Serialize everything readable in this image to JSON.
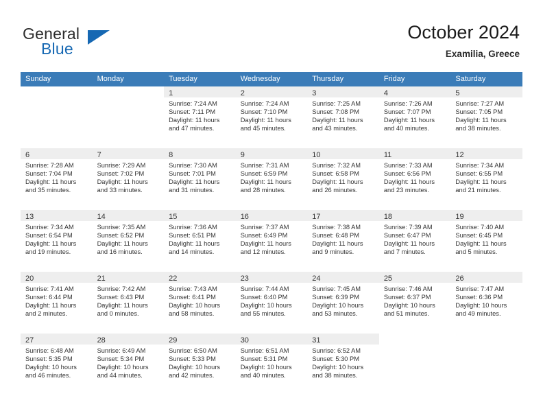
{
  "brand": {
    "name_top": "General",
    "name_bottom": "Blue",
    "accent_color": "#1668b3"
  },
  "header": {
    "month_title": "October 2024",
    "location": "Examilia, Greece"
  },
  "calendar": {
    "header_bg": "#3b7cb8",
    "separator_color": "#1668b3",
    "daynum_band_color": "#eeeeee",
    "weekdays": [
      "Sunday",
      "Monday",
      "Tuesday",
      "Wednesday",
      "Thursday",
      "Friday",
      "Saturday"
    ],
    "weeks": [
      [
        {
          "day": "",
          "sunrise": "",
          "sunset": "",
          "daylight_line1": "",
          "daylight_line2": ""
        },
        {
          "day": "",
          "sunrise": "",
          "sunset": "",
          "daylight_line1": "",
          "daylight_line2": ""
        },
        {
          "day": "1",
          "sunrise": "Sunrise: 7:24 AM",
          "sunset": "Sunset: 7:11 PM",
          "daylight_line1": "Daylight: 11 hours",
          "daylight_line2": "and 47 minutes."
        },
        {
          "day": "2",
          "sunrise": "Sunrise: 7:24 AM",
          "sunset": "Sunset: 7:10 PM",
          "daylight_line1": "Daylight: 11 hours",
          "daylight_line2": "and 45 minutes."
        },
        {
          "day": "3",
          "sunrise": "Sunrise: 7:25 AM",
          "sunset": "Sunset: 7:08 PM",
          "daylight_line1": "Daylight: 11 hours",
          "daylight_line2": "and 43 minutes."
        },
        {
          "day": "4",
          "sunrise": "Sunrise: 7:26 AM",
          "sunset": "Sunset: 7:07 PM",
          "daylight_line1": "Daylight: 11 hours",
          "daylight_line2": "and 40 minutes."
        },
        {
          "day": "5",
          "sunrise": "Sunrise: 7:27 AM",
          "sunset": "Sunset: 7:05 PM",
          "daylight_line1": "Daylight: 11 hours",
          "daylight_line2": "and 38 minutes."
        }
      ],
      [
        {
          "day": "6",
          "sunrise": "Sunrise: 7:28 AM",
          "sunset": "Sunset: 7:04 PM",
          "daylight_line1": "Daylight: 11 hours",
          "daylight_line2": "and 35 minutes."
        },
        {
          "day": "7",
          "sunrise": "Sunrise: 7:29 AM",
          "sunset": "Sunset: 7:02 PM",
          "daylight_line1": "Daylight: 11 hours",
          "daylight_line2": "and 33 minutes."
        },
        {
          "day": "8",
          "sunrise": "Sunrise: 7:30 AM",
          "sunset": "Sunset: 7:01 PM",
          "daylight_line1": "Daylight: 11 hours",
          "daylight_line2": "and 31 minutes."
        },
        {
          "day": "9",
          "sunrise": "Sunrise: 7:31 AM",
          "sunset": "Sunset: 6:59 PM",
          "daylight_line1": "Daylight: 11 hours",
          "daylight_line2": "and 28 minutes."
        },
        {
          "day": "10",
          "sunrise": "Sunrise: 7:32 AM",
          "sunset": "Sunset: 6:58 PM",
          "daylight_line1": "Daylight: 11 hours",
          "daylight_line2": "and 26 minutes."
        },
        {
          "day": "11",
          "sunrise": "Sunrise: 7:33 AM",
          "sunset": "Sunset: 6:56 PM",
          "daylight_line1": "Daylight: 11 hours",
          "daylight_line2": "and 23 minutes."
        },
        {
          "day": "12",
          "sunrise": "Sunrise: 7:34 AM",
          "sunset": "Sunset: 6:55 PM",
          "daylight_line1": "Daylight: 11 hours",
          "daylight_line2": "and 21 minutes."
        }
      ],
      [
        {
          "day": "13",
          "sunrise": "Sunrise: 7:34 AM",
          "sunset": "Sunset: 6:54 PM",
          "daylight_line1": "Daylight: 11 hours",
          "daylight_line2": "and 19 minutes."
        },
        {
          "day": "14",
          "sunrise": "Sunrise: 7:35 AM",
          "sunset": "Sunset: 6:52 PM",
          "daylight_line1": "Daylight: 11 hours",
          "daylight_line2": "and 16 minutes."
        },
        {
          "day": "15",
          "sunrise": "Sunrise: 7:36 AM",
          "sunset": "Sunset: 6:51 PM",
          "daylight_line1": "Daylight: 11 hours",
          "daylight_line2": "and 14 minutes."
        },
        {
          "day": "16",
          "sunrise": "Sunrise: 7:37 AM",
          "sunset": "Sunset: 6:49 PM",
          "daylight_line1": "Daylight: 11 hours",
          "daylight_line2": "and 12 minutes."
        },
        {
          "day": "17",
          "sunrise": "Sunrise: 7:38 AM",
          "sunset": "Sunset: 6:48 PM",
          "daylight_line1": "Daylight: 11 hours",
          "daylight_line2": "and 9 minutes."
        },
        {
          "day": "18",
          "sunrise": "Sunrise: 7:39 AM",
          "sunset": "Sunset: 6:47 PM",
          "daylight_line1": "Daylight: 11 hours",
          "daylight_line2": "and 7 minutes."
        },
        {
          "day": "19",
          "sunrise": "Sunrise: 7:40 AM",
          "sunset": "Sunset: 6:45 PM",
          "daylight_line1": "Daylight: 11 hours",
          "daylight_line2": "and 5 minutes."
        }
      ],
      [
        {
          "day": "20",
          "sunrise": "Sunrise: 7:41 AM",
          "sunset": "Sunset: 6:44 PM",
          "daylight_line1": "Daylight: 11 hours",
          "daylight_line2": "and 2 minutes."
        },
        {
          "day": "21",
          "sunrise": "Sunrise: 7:42 AM",
          "sunset": "Sunset: 6:43 PM",
          "daylight_line1": "Daylight: 11 hours",
          "daylight_line2": "and 0 minutes."
        },
        {
          "day": "22",
          "sunrise": "Sunrise: 7:43 AM",
          "sunset": "Sunset: 6:41 PM",
          "daylight_line1": "Daylight: 10 hours",
          "daylight_line2": "and 58 minutes."
        },
        {
          "day": "23",
          "sunrise": "Sunrise: 7:44 AM",
          "sunset": "Sunset: 6:40 PM",
          "daylight_line1": "Daylight: 10 hours",
          "daylight_line2": "and 55 minutes."
        },
        {
          "day": "24",
          "sunrise": "Sunrise: 7:45 AM",
          "sunset": "Sunset: 6:39 PM",
          "daylight_line1": "Daylight: 10 hours",
          "daylight_line2": "and 53 minutes."
        },
        {
          "day": "25",
          "sunrise": "Sunrise: 7:46 AM",
          "sunset": "Sunset: 6:37 PM",
          "daylight_line1": "Daylight: 10 hours",
          "daylight_line2": "and 51 minutes."
        },
        {
          "day": "26",
          "sunrise": "Sunrise: 7:47 AM",
          "sunset": "Sunset: 6:36 PM",
          "daylight_line1": "Daylight: 10 hours",
          "daylight_line2": "and 49 minutes."
        }
      ],
      [
        {
          "day": "27",
          "sunrise": "Sunrise: 6:48 AM",
          "sunset": "Sunset: 5:35 PM",
          "daylight_line1": "Daylight: 10 hours",
          "daylight_line2": "and 46 minutes."
        },
        {
          "day": "28",
          "sunrise": "Sunrise: 6:49 AM",
          "sunset": "Sunset: 5:34 PM",
          "daylight_line1": "Daylight: 10 hours",
          "daylight_line2": "and 44 minutes."
        },
        {
          "day": "29",
          "sunrise": "Sunrise: 6:50 AM",
          "sunset": "Sunset: 5:33 PM",
          "daylight_line1": "Daylight: 10 hours",
          "daylight_line2": "and 42 minutes."
        },
        {
          "day": "30",
          "sunrise": "Sunrise: 6:51 AM",
          "sunset": "Sunset: 5:31 PM",
          "daylight_line1": "Daylight: 10 hours",
          "daylight_line2": "and 40 minutes."
        },
        {
          "day": "31",
          "sunrise": "Sunrise: 6:52 AM",
          "sunset": "Sunset: 5:30 PM",
          "daylight_line1": "Daylight: 10 hours",
          "daylight_line2": "and 38 minutes."
        },
        {
          "day": "",
          "sunrise": "",
          "sunset": "",
          "daylight_line1": "",
          "daylight_line2": ""
        },
        {
          "day": "",
          "sunrise": "",
          "sunset": "",
          "daylight_line1": "",
          "daylight_line2": ""
        }
      ]
    ]
  }
}
